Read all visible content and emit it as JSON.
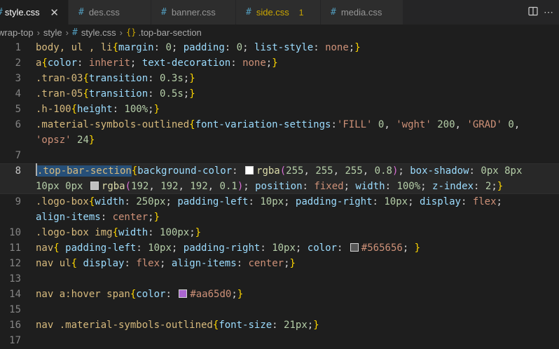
{
  "tabs": [
    {
      "label": "style.css",
      "active": true,
      "close": "✕"
    },
    {
      "label": "des.css"
    },
    {
      "label": "banner.css"
    },
    {
      "label": "side.css",
      "modified": true,
      "badge": "1"
    },
    {
      "label": "media.css"
    }
  ],
  "actions": {
    "split_icon": "split-editor-icon",
    "more_icon": "more-actions-icon"
  },
  "breadcrumb": {
    "folder1": "wrap-top",
    "folder2": "style",
    "file": "style.css",
    "symbol": ".top-bar-section"
  },
  "colors": {
    "accent": "#007acc",
    "selector": "#d7ba7d",
    "property": "#9cdcfe",
    "value": "#ce9178",
    "number": "#b5cea8",
    "swatches": [
      "#ffffff",
      "#c0c0c0",
      "#565656",
      "#aa65d0"
    ]
  },
  "lines": [
    {
      "num": "1",
      "code": [
        [
          "tk-sel",
          "body, ul , li"
        ],
        [
          "tk-brace",
          "{"
        ],
        [
          "tk-prop",
          "margin"
        ],
        [
          "tk-p",
          ": "
        ],
        [
          "tk-num",
          "0"
        ],
        [
          "tk-p",
          "; "
        ],
        [
          "tk-prop",
          "padding"
        ],
        [
          "tk-p",
          ": "
        ],
        [
          "tk-num",
          "0"
        ],
        [
          "tk-p",
          "; "
        ],
        [
          "tk-prop",
          "list-style"
        ],
        [
          "tk-p",
          ": "
        ],
        [
          "tk-kw",
          "none"
        ],
        [
          "tk-p",
          ";"
        ],
        [
          "tk-brace",
          "}"
        ]
      ]
    },
    {
      "num": "2",
      "code": [
        [
          "tk-sel",
          "a"
        ],
        [
          "tk-brace",
          "{"
        ],
        [
          "tk-prop",
          "color"
        ],
        [
          "tk-p",
          ": "
        ],
        [
          "tk-kw",
          "inherit"
        ],
        [
          "tk-p",
          "; "
        ],
        [
          "tk-prop",
          "text-decoration"
        ],
        [
          "tk-p",
          ": "
        ],
        [
          "tk-kw",
          "none"
        ],
        [
          "tk-p",
          ";"
        ],
        [
          "tk-brace",
          "}"
        ]
      ]
    },
    {
      "num": "3",
      "code": [
        [
          "tk-sel",
          ".tran-03"
        ],
        [
          "tk-brace",
          "{"
        ],
        [
          "tk-prop",
          "transition"
        ],
        [
          "tk-p",
          ": "
        ],
        [
          "tk-num",
          "0.3s"
        ],
        [
          "tk-p",
          ";"
        ],
        [
          "tk-brace",
          "}"
        ]
      ]
    },
    {
      "num": "4",
      "code": [
        [
          "tk-sel",
          ".tran-05"
        ],
        [
          "tk-brace",
          "{"
        ],
        [
          "tk-prop",
          "transition"
        ],
        [
          "tk-p",
          ": "
        ],
        [
          "tk-num",
          "0.5s"
        ],
        [
          "tk-p",
          ";"
        ],
        [
          "tk-brace",
          "}"
        ]
      ]
    },
    {
      "num": "5",
      "code": [
        [
          "tk-sel",
          ".h-100"
        ],
        [
          "tk-brace",
          "{"
        ],
        [
          "tk-prop",
          "height"
        ],
        [
          "tk-p",
          ": "
        ],
        [
          "tk-num",
          "100%"
        ],
        [
          "tk-p",
          ";"
        ],
        [
          "tk-brace",
          "}"
        ]
      ]
    },
    {
      "num": "6",
      "code": [
        [
          "tk-sel",
          ".material-symbols-outlined"
        ],
        [
          "tk-brace",
          "{"
        ],
        [
          "tk-prop",
          "font-variation-settings"
        ],
        [
          "tk-p",
          ":"
        ],
        [
          "tk-str",
          "'FILL'"
        ],
        [
          "tk-p",
          " "
        ],
        [
          "tk-num",
          "0"
        ],
        [
          "tk-p",
          ", "
        ],
        [
          "tk-str",
          "'wght'"
        ],
        [
          "tk-p",
          " "
        ],
        [
          "tk-num",
          "200"
        ],
        [
          "tk-p",
          ", "
        ],
        [
          "tk-str",
          "'GRAD'"
        ],
        [
          "tk-p",
          " "
        ],
        [
          "tk-num",
          "0"
        ],
        [
          "tk-p",
          ","
        ]
      ]
    },
    {
      "num": "",
      "code": [
        [
          "tk-str",
          "'opsz'"
        ],
        [
          "tk-p",
          " "
        ],
        [
          "tk-num",
          "24"
        ],
        [
          "tk-brace",
          "}"
        ]
      ]
    },
    {
      "num": "7",
      "code": []
    },
    {
      "num": "8",
      "current": true,
      "hl": "first",
      "code": [
        [
          "sel",
          ".top-bar-section"
        ],
        [
          "tk-brace",
          "{"
        ],
        [
          "tk-prop",
          "background-color"
        ],
        [
          "tk-p",
          ": "
        ],
        [
          "sw",
          "#ffffff"
        ],
        [
          "tk-fn",
          "rgba"
        ],
        [
          "tk-brace2",
          "("
        ],
        [
          "tk-num",
          "255"
        ],
        [
          "tk-p",
          ", "
        ],
        [
          "tk-num",
          "255"
        ],
        [
          "tk-p",
          ", "
        ],
        [
          "tk-num",
          "255"
        ],
        [
          "tk-p",
          ", "
        ],
        [
          "tk-num",
          "0.8"
        ],
        [
          "tk-brace2",
          ")"
        ],
        [
          "tk-p",
          "; "
        ],
        [
          "tk-prop",
          "box-shadow"
        ],
        [
          "tk-p",
          ": "
        ],
        [
          "tk-num",
          "0px"
        ],
        [
          "tk-p",
          " "
        ],
        [
          "tk-num",
          "8px"
        ]
      ]
    },
    {
      "num": "",
      "hl": "last",
      "code": [
        [
          "tk-num",
          "10px"
        ],
        [
          "tk-p",
          " "
        ],
        [
          "tk-num",
          "0px"
        ],
        [
          "tk-p",
          " "
        ],
        [
          "sw",
          "#c0c0c0"
        ],
        [
          "tk-fn",
          "rgba"
        ],
        [
          "tk-brace2",
          "("
        ],
        [
          "tk-num",
          "192"
        ],
        [
          "tk-p",
          ", "
        ],
        [
          "tk-num",
          "192"
        ],
        [
          "tk-p",
          ", "
        ],
        [
          "tk-num",
          "192"
        ],
        [
          "tk-p",
          ", "
        ],
        [
          "tk-num",
          "0.1"
        ],
        [
          "tk-brace2",
          ")"
        ],
        [
          "tk-p",
          "; "
        ],
        [
          "tk-prop",
          "position"
        ],
        [
          "tk-p",
          ": "
        ],
        [
          "tk-kw",
          "fixed"
        ],
        [
          "tk-p",
          "; "
        ],
        [
          "tk-prop",
          "width"
        ],
        [
          "tk-p",
          ": "
        ],
        [
          "tk-num",
          "100%"
        ],
        [
          "tk-p",
          "; "
        ],
        [
          "tk-prop",
          "z-index"
        ],
        [
          "tk-p",
          ": "
        ],
        [
          "tk-num",
          "2"
        ],
        [
          "tk-p",
          ";"
        ],
        [
          "tk-brace",
          "}"
        ]
      ]
    },
    {
      "num": "9",
      "code": [
        [
          "tk-sel",
          ".logo-box"
        ],
        [
          "tk-brace",
          "{"
        ],
        [
          "tk-prop",
          "width"
        ],
        [
          "tk-p",
          ": "
        ],
        [
          "tk-num",
          "250px"
        ],
        [
          "tk-p",
          "; "
        ],
        [
          "tk-prop",
          "padding-left"
        ],
        [
          "tk-p",
          ": "
        ],
        [
          "tk-num",
          "10px"
        ],
        [
          "tk-p",
          "; "
        ],
        [
          "tk-prop",
          "padding-right"
        ],
        [
          "tk-p",
          ": "
        ],
        [
          "tk-num",
          "10px"
        ],
        [
          "tk-p",
          "; "
        ],
        [
          "tk-prop",
          "display"
        ],
        [
          "tk-p",
          ": "
        ],
        [
          "tk-kw",
          "flex"
        ],
        [
          "tk-p",
          ";"
        ]
      ]
    },
    {
      "num": "",
      "code": [
        [
          "tk-prop",
          "align-items"
        ],
        [
          "tk-p",
          ": "
        ],
        [
          "tk-kw",
          "center"
        ],
        [
          "tk-p",
          ";"
        ],
        [
          "tk-brace",
          "}"
        ]
      ]
    },
    {
      "num": "10",
      "code": [
        [
          "tk-sel",
          ".logo-box img"
        ],
        [
          "tk-brace",
          "{"
        ],
        [
          "tk-prop",
          "width"
        ],
        [
          "tk-p",
          ": "
        ],
        [
          "tk-num",
          "100px"
        ],
        [
          "tk-p",
          ";"
        ],
        [
          "tk-brace",
          "}"
        ]
      ]
    },
    {
      "num": "11",
      "code": [
        [
          "tk-sel",
          "nav"
        ],
        [
          "tk-brace",
          "{"
        ],
        [
          "tk-p",
          " "
        ],
        [
          "tk-prop",
          "padding-left"
        ],
        [
          "tk-p",
          ": "
        ],
        [
          "tk-num",
          "10px"
        ],
        [
          "tk-p",
          "; "
        ],
        [
          "tk-prop",
          "padding-right"
        ],
        [
          "tk-p",
          ": "
        ],
        [
          "tk-num",
          "10px"
        ],
        [
          "tk-p",
          "; "
        ],
        [
          "tk-prop",
          "color"
        ],
        [
          "tk-p",
          ": "
        ],
        [
          "sw",
          "#565656"
        ],
        [
          "tk-hex",
          "#565656"
        ],
        [
          "tk-p",
          "; "
        ],
        [
          "tk-brace",
          "}"
        ]
      ]
    },
    {
      "num": "12",
      "code": [
        [
          "tk-sel",
          "nav ul"
        ],
        [
          "tk-brace",
          "{"
        ],
        [
          "tk-p",
          " "
        ],
        [
          "tk-prop",
          "display"
        ],
        [
          "tk-p",
          ": "
        ],
        [
          "tk-kw",
          "flex"
        ],
        [
          "tk-p",
          "; "
        ],
        [
          "tk-prop",
          "align-items"
        ],
        [
          "tk-p",
          ": "
        ],
        [
          "tk-kw",
          "center"
        ],
        [
          "tk-p",
          ";"
        ],
        [
          "tk-brace",
          "}"
        ]
      ]
    },
    {
      "num": "13",
      "code": []
    },
    {
      "num": "14",
      "code": [
        [
          "tk-sel",
          "nav a:hover span"
        ],
        [
          "tk-brace",
          "{"
        ],
        [
          "tk-prop",
          "color"
        ],
        [
          "tk-p",
          ": "
        ],
        [
          "sw",
          "#aa65d0"
        ],
        [
          "tk-hex",
          "#aa65d0"
        ],
        [
          "tk-p",
          ";"
        ],
        [
          "tk-brace",
          "}"
        ]
      ]
    },
    {
      "num": "15",
      "code": []
    },
    {
      "num": "16",
      "code": [
        [
          "tk-sel",
          "nav .material-symbols-outlined"
        ],
        [
          "tk-brace",
          "{"
        ],
        [
          "tk-prop",
          "font-size"
        ],
        [
          "tk-p",
          ": "
        ],
        [
          "tk-num",
          "21px"
        ],
        [
          "tk-p",
          ";"
        ],
        [
          "tk-brace",
          "}"
        ]
      ]
    },
    {
      "num": "17",
      "code": []
    }
  ]
}
